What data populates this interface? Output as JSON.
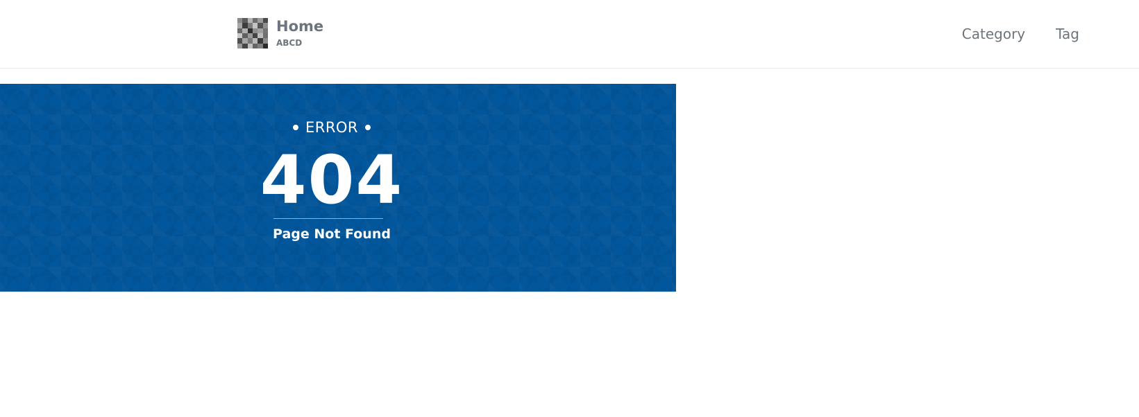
{
  "header": {
    "brand": {
      "title": "Home",
      "subtitle": "ABCD",
      "logo_icon": "avatar-icon"
    },
    "nav": [
      {
        "label": "Category"
      },
      {
        "label": "Tag"
      }
    ]
  },
  "hero": {
    "background_color": "#02569b",
    "error_label": "ERROR",
    "code": "404",
    "message": "Page Not Found"
  },
  "colors": {
    "nav_text": "#6c757d",
    "hero_bg": "#02569b",
    "hero_text": "#ffffff"
  }
}
